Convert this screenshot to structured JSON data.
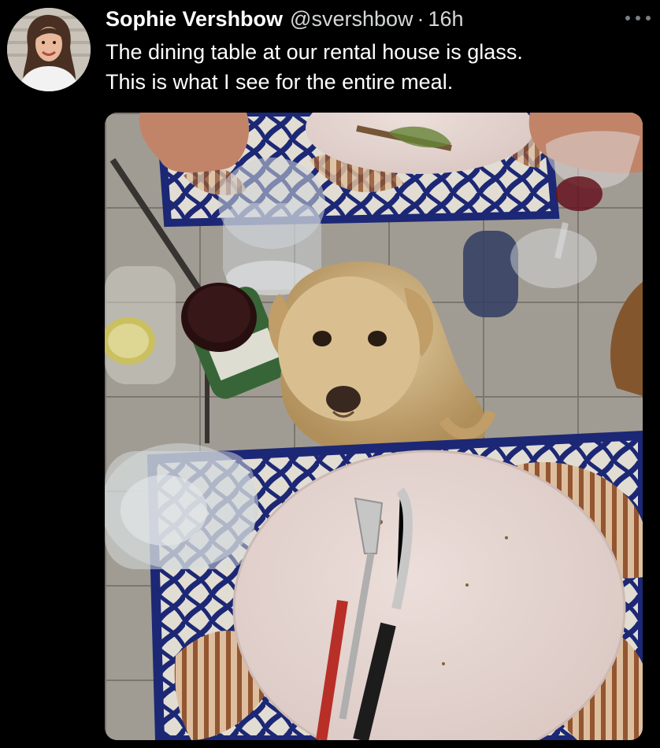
{
  "tweet": {
    "author": {
      "display_name": "Sophie Vershbow",
      "handle": "@svershbow",
      "separator": "·",
      "time": "16h",
      "avatar_icon": "profile-photo"
    },
    "more_icon": "more-horizontal-icon",
    "text_lines": [
      "The dining table at our rental house is glass.",
      "This is what I see for the entire meal."
    ],
    "media": {
      "kind": "photo"
    }
  },
  "colors": {
    "background": "#000000",
    "text": "#ffffff",
    "secondary_text": "#d5d7d9",
    "more_dots": "#7a7f84"
  }
}
